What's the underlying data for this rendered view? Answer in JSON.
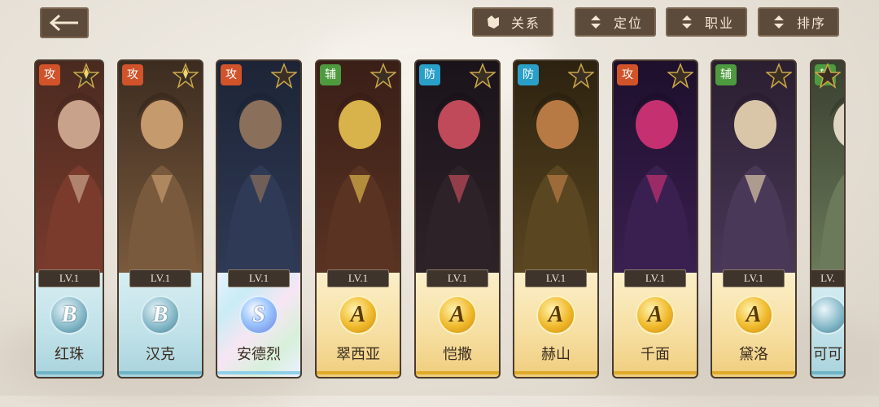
{
  "toolbar": {
    "back_icon": "back-arrow-icon",
    "relation_label": "关系",
    "position_label": "定位",
    "job_label": "职业",
    "sort_label": "排序"
  },
  "colors": {
    "attack": "#d1532a",
    "defense": "#2aa0c8",
    "support": "#4e9a3e",
    "button_bg": "#5c4a3a"
  },
  "cards": [
    {
      "name": "红珠",
      "role": "攻",
      "level": "LV.1",
      "grade": "B",
      "rarity": "diamond"
    },
    {
      "name": "汉克",
      "role": "攻",
      "level": "LV.1",
      "grade": "B",
      "rarity": "diamond"
    },
    {
      "name": "安德烈",
      "role": "攻",
      "level": "LV.1",
      "grade": "S",
      "rarity": "star"
    },
    {
      "name": "翠西亚",
      "role": "辅",
      "level": "LV.1",
      "grade": "A",
      "rarity": "star"
    },
    {
      "name": "恺撒",
      "role": "防",
      "level": "LV.1",
      "grade": "A",
      "rarity": "star"
    },
    {
      "name": "赫山",
      "role": "防",
      "level": "LV.1",
      "grade": "A",
      "rarity": "star"
    },
    {
      "name": "千面",
      "role": "攻",
      "level": "LV.1",
      "grade": "A",
      "rarity": "star"
    },
    {
      "name": "黛洛",
      "role": "辅",
      "level": "LV.1",
      "grade": "A",
      "rarity": "star"
    },
    {
      "name": "可可",
      "role": "辅",
      "level": "LV.",
      "grade": "",
      "rarity": "star"
    }
  ]
}
